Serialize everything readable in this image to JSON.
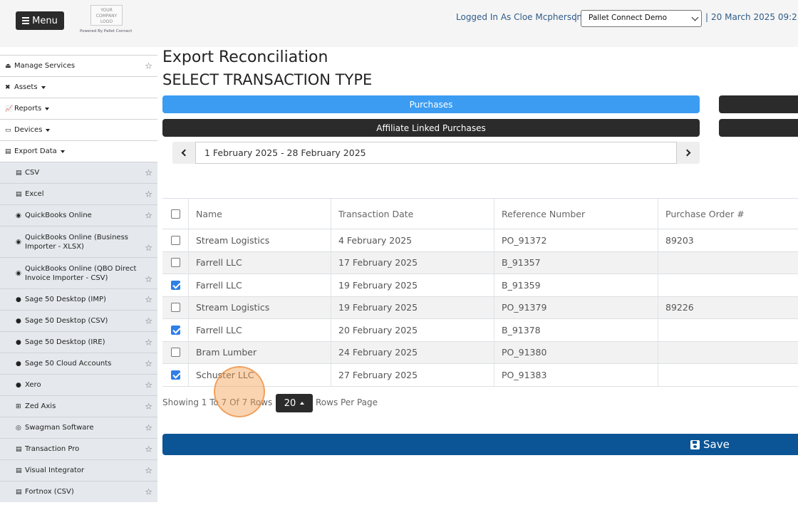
{
  "header": {
    "menu_label": "Menu",
    "logo_text": "YOUR COMPANY LOGO",
    "powered_by": "Powered By Pallet Connect",
    "logged_in": "Logged In As Cloe Mcpherson",
    "separator": "|",
    "company_select": "Pallet Connect Demo",
    "date": "20 March 2025 09:2"
  },
  "sidebar": {
    "items": [
      {
        "label": "Manage Services",
        "icon": "eject-icon",
        "glyph": "⏏",
        "star": true
      },
      {
        "label": "Assets",
        "icon": "tools-icon",
        "glyph": "✖",
        "dropdown": true
      },
      {
        "label": "Reports",
        "icon": "chart-icon",
        "glyph": "📈",
        "dropdown": true
      },
      {
        "label": "Devices",
        "icon": "monitor-icon",
        "glyph": "▭",
        "dropdown": true
      },
      {
        "label": "Export Data",
        "icon": "file-export-icon",
        "glyph": "▤",
        "dropdown": true
      },
      {
        "label": "CSV",
        "icon": "csv-file-icon",
        "glyph": "▤",
        "sub": true,
        "star": true
      },
      {
        "label": "Excel",
        "icon": "excel-file-icon",
        "glyph": "▤",
        "sub": true,
        "star": true
      },
      {
        "label": "QuickBooks Online",
        "icon": "quickbooks-icon",
        "glyph": "◉",
        "sub": true,
        "star": true
      },
      {
        "label": "QuickBooks Online (Business Importer - XLSX)",
        "icon": "quickbooks-icon",
        "glyph": "◉",
        "sub": true,
        "tall": true,
        "star": true
      },
      {
        "label": "QuickBooks Online (QBO Direct Invoice Importer - CSV)",
        "icon": "quickbooks-icon",
        "glyph": "◉",
        "sub": true,
        "tall": true,
        "star": true
      },
      {
        "label": "Sage 50 Desktop (IMP)",
        "icon": "sage-icon",
        "glyph": "●",
        "sub": true,
        "star": true
      },
      {
        "label": "Sage 50 Desktop (CSV)",
        "icon": "sage-icon",
        "glyph": "●",
        "sub": true,
        "star": true
      },
      {
        "label": "Sage 50 Desktop (IRE)",
        "icon": "sage-icon",
        "glyph": "●",
        "sub": true,
        "star": true
      },
      {
        "label": "Sage 50 Cloud Accounts",
        "icon": "sage-icon",
        "glyph": "●",
        "sub": true,
        "star": true
      },
      {
        "label": "Xero",
        "icon": "xero-icon",
        "glyph": "●",
        "sub": true,
        "star": true
      },
      {
        "label": "Zed Axis",
        "icon": "zed-axis-icon",
        "glyph": "⊞",
        "sub": true,
        "star": true
      },
      {
        "label": "Swagman Software",
        "icon": "swagman-icon",
        "glyph": "◎",
        "sub": true,
        "star": true
      },
      {
        "label": "Transaction Pro",
        "icon": "file-export-icon",
        "glyph": "▤",
        "sub": true,
        "star": true
      },
      {
        "label": "Visual Integrator",
        "icon": "file-export-icon",
        "glyph": "▤",
        "sub": true,
        "star": true
      },
      {
        "label": "Fortnox (CSV)",
        "icon": "file-export-icon",
        "glyph": "▤",
        "sub": true,
        "star": true
      }
    ]
  },
  "main": {
    "page_title": "Export Reconciliation",
    "section_title": "SELECT TRANSACTION TYPE",
    "type_buttons": {
      "purchases": "Purchases",
      "affiliate_linked": "Affiliate Linked Purchases"
    },
    "date_range": "1 February 2025 - 28 February 2025",
    "table": {
      "columns": [
        "Name",
        "Transaction Date",
        "Reference Number",
        "Purchase Order #"
      ],
      "rows": [
        {
          "checked": false,
          "name": "Stream Logistics",
          "date": "4 February 2025",
          "ref": "PO_91372",
          "po": "89203"
        },
        {
          "checked": false,
          "name": "Farrell LLC",
          "date": "17 February 2025",
          "ref": "B_91357",
          "po": ""
        },
        {
          "checked": true,
          "name": "Farrell LLC",
          "date": "19 February 2025",
          "ref": "B_91359",
          "po": ""
        },
        {
          "checked": false,
          "name": "Stream Logistics",
          "date": "19 February 2025",
          "ref": "PO_91379",
          "po": "89226"
        },
        {
          "checked": true,
          "name": "Farrell LLC",
          "date": "20 February 2025",
          "ref": "B_91378",
          "po": ""
        },
        {
          "checked": false,
          "name": "Bram Lumber",
          "date": "24 February 2025",
          "ref": "PO_91380",
          "po": ""
        },
        {
          "checked": true,
          "name": "Schuster LLC",
          "date": "27 February 2025",
          "ref": "PO_91383",
          "po": ""
        }
      ]
    },
    "pagination": {
      "showing": "Showing 1 To 7 Of 7 Rows",
      "per_page": "20",
      "rows_per_page": "Rows Per Page"
    },
    "save_label": "Save"
  },
  "colors": {
    "active_type": "#3b9cf2",
    "dark_button": "#2b2b2b",
    "save_bar": "#0b5596",
    "link_text": "#2f5c8a"
  }
}
